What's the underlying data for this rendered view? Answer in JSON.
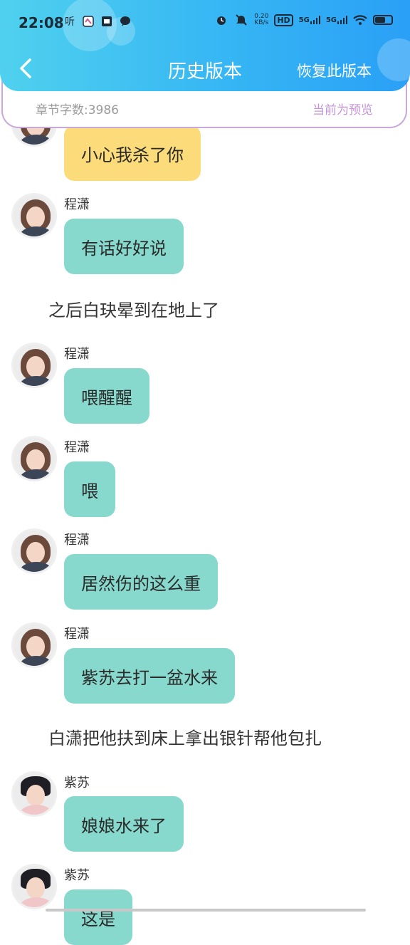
{
  "status_bar": {
    "time": "22:08",
    "left_text": "听",
    "net_speed_top": "0.20",
    "net_speed_bottom": "KB/s",
    "hd_label": "HD",
    "signal1": "5G",
    "signal2": "5G",
    "battery_percent": 0.65
  },
  "header": {
    "title": "历史版本",
    "restore_label": "恢复此版本"
  },
  "info": {
    "word_count": "章节字数:3986",
    "preview_tag": "当前为预览"
  },
  "messages": [
    {
      "kind": "bubble",
      "speaker": "",
      "text": "小心我杀了你",
      "color": "#fcdc7a"
    },
    {
      "kind": "bubble",
      "speaker": "程潇",
      "text": "有话好好说",
      "color": "#88d9cd"
    },
    {
      "kind": "narration",
      "text": "之后白玦晕到在地上了"
    },
    {
      "kind": "bubble",
      "speaker": "程潇",
      "text": "喂醒醒",
      "color": "#88d9cd"
    },
    {
      "kind": "bubble",
      "speaker": "程潇",
      "text": "喂",
      "color": "#88d9cd"
    },
    {
      "kind": "bubble",
      "speaker": "程潇",
      "text": "居然伤的这么重",
      "color": "#88d9cd"
    },
    {
      "kind": "bubble",
      "speaker": "程潇",
      "text": "紫苏去打一盆水来",
      "color": "#88d9cd"
    },
    {
      "kind": "narration",
      "text": "白潇把他扶到床上拿出银针帮他包扎"
    },
    {
      "kind": "bubble",
      "speaker": "紫苏",
      "text": "娘娘水来了",
      "color": "#88d9cd"
    },
    {
      "kind": "bubble",
      "speaker": "紫苏",
      "text": "这是",
      "color": "#88d9cd"
    }
  ],
  "colors": {
    "header_start": "#4fd1ee",
    "header_end": "#2aa0f6",
    "bubble_teal": "#88d9cd",
    "bubble_yellow": "#fcdc7a",
    "card_border": "#c9a9d9",
    "preview_purple": "#c595d8"
  }
}
